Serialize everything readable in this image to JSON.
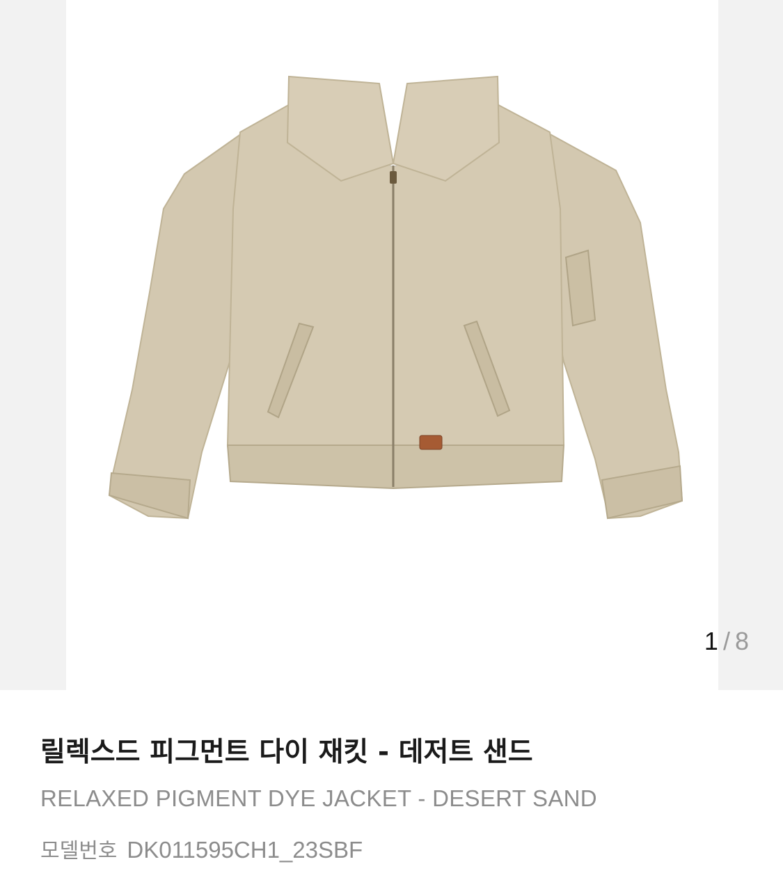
{
  "gallery": {
    "current_index": "1",
    "separator": "/",
    "total_count": "8",
    "image_subject": "jacket"
  },
  "product": {
    "title_ko": "릴렉스드 피그먼트 다이 재킷 - 데저트 샌드",
    "title_en": "RELAXED PIGMENT DYE JACKET - DESERT SAND",
    "model_label": "모델번호",
    "model_number": "DK011595CH1_23SBF"
  },
  "colors": {
    "jacket": "#d3c8b0",
    "jacket_shadow": "#bfb396",
    "background": "#ffffff",
    "side_panel": "#f2f2f2",
    "text_primary": "#1a1a1a",
    "text_secondary": "#8c8c8c"
  }
}
